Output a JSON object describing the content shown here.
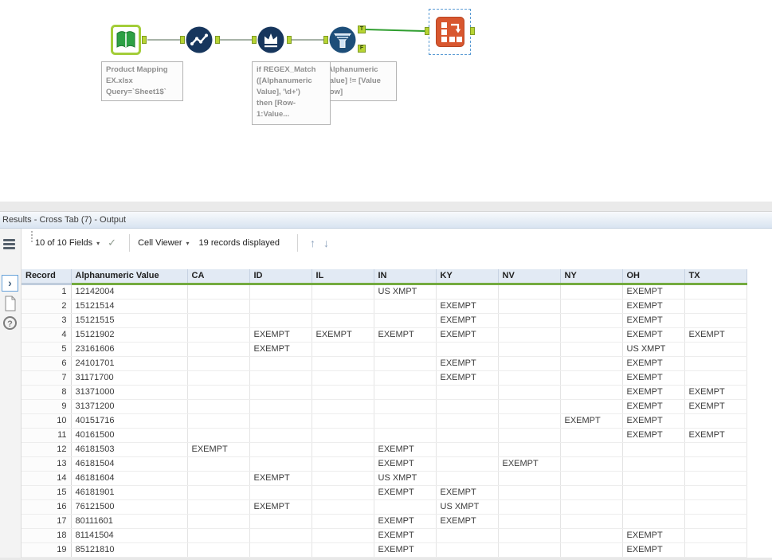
{
  "colors": {
    "anchor_green": "#b7d433",
    "tool_navy": "#17365d",
    "crosstab_orange": "#d8572f",
    "quality_bar_green": "#74ab3f",
    "connection_active_green": "#2f9e2f"
  },
  "canvas": {
    "annotations": {
      "input_data": "Product Mapping\nEX.xlsx\nQuery=`Sheet1$`",
      "multi_row_formula": "if REGEX_Match\n([Alphanumeric\nValue], '\\d+')\nthen [Row-\n1:Value...",
      "filter": "[Alphanumeric\nValue] != [Value\nLow]"
    },
    "filter_outputs": {
      "true_label": "T",
      "false_label": "F"
    }
  },
  "results": {
    "title": "Results - Cross Tab (7) - Output",
    "toolbar": {
      "fields_label": "10 of 10 Fields",
      "cell_viewer_label": "Cell Viewer",
      "records_label": "19 records displayed"
    },
    "table": {
      "columns": [
        "Record",
        "Alphanumeric Value",
        "CA",
        "ID",
        "IL",
        "IN",
        "KY",
        "NV",
        "NY",
        "OH",
        "TX"
      ],
      "rows": [
        [
          "1",
          "12142004",
          "",
          "",
          "",
          "US XMPT",
          "",
          "",
          "",
          "EXEMPT",
          ""
        ],
        [
          "2",
          "15121514",
          "",
          "",
          "",
          "",
          "EXEMPT",
          "",
          "",
          "EXEMPT",
          ""
        ],
        [
          "3",
          "15121515",
          "",
          "",
          "",
          "",
          "EXEMPT",
          "",
          "",
          "EXEMPT",
          ""
        ],
        [
          "4",
          "15121902",
          "",
          "EXEMPT",
          "EXEMPT",
          "EXEMPT",
          "EXEMPT",
          "",
          "",
          "EXEMPT",
          "EXEMPT"
        ],
        [
          "5",
          "23161606",
          "",
          "EXEMPT",
          "",
          "",
          "",
          "",
          "",
          "US XMPT",
          ""
        ],
        [
          "6",
          "24101701",
          "",
          "",
          "",
          "",
          "EXEMPT",
          "",
          "",
          "EXEMPT",
          ""
        ],
        [
          "7",
          "31171700",
          "",
          "",
          "",
          "",
          "EXEMPT",
          "",
          "",
          "EXEMPT",
          ""
        ],
        [
          "8",
          "31371000",
          "",
          "",
          "",
          "",
          "",
          "",
          "",
          "EXEMPT",
          "EXEMPT"
        ],
        [
          "9",
          "31371200",
          "",
          "",
          "",
          "",
          "",
          "",
          "",
          "EXEMPT",
          "EXEMPT"
        ],
        [
          "10",
          "40151716",
          "",
          "",
          "",
          "",
          "",
          "",
          "EXEMPT",
          "EXEMPT",
          ""
        ],
        [
          "11",
          "40161500",
          "",
          "",
          "",
          "",
          "",
          "",
          "",
          "EXEMPT",
          "EXEMPT"
        ],
        [
          "12",
          "46181503",
          "EXEMPT",
          "",
          "",
          "EXEMPT",
          "",
          "",
          "",
          "",
          ""
        ],
        [
          "13",
          "46181504",
          "",
          "",
          "",
          "EXEMPT",
          "",
          "EXEMPT",
          "",
          "",
          ""
        ],
        [
          "14",
          "46181604",
          "",
          "EXEMPT",
          "",
          "US XMPT",
          "",
          "",
          "",
          "",
          ""
        ],
        [
          "15",
          "46181901",
          "",
          "",
          "",
          "EXEMPT",
          "EXEMPT",
          "",
          "",
          "",
          ""
        ],
        [
          "16",
          "76121500",
          "",
          "EXEMPT",
          "",
          "",
          "US XMPT",
          "",
          "",
          "",
          ""
        ],
        [
          "17",
          "80111601",
          "",
          "",
          "",
          "EXEMPT",
          "EXEMPT",
          "",
          "",
          "",
          ""
        ],
        [
          "18",
          "81141504",
          "",
          "",
          "",
          "EXEMPT",
          "",
          "",
          "",
          "EXEMPT",
          ""
        ],
        [
          "19",
          "85121810",
          "",
          "",
          "",
          "EXEMPT",
          "",
          "",
          "",
          "EXEMPT",
          ""
        ]
      ]
    }
  },
  "icons": {
    "caret": "▾",
    "check": "✓",
    "up": "↑",
    "down": "↓",
    "chevron": "›",
    "question": "?"
  }
}
